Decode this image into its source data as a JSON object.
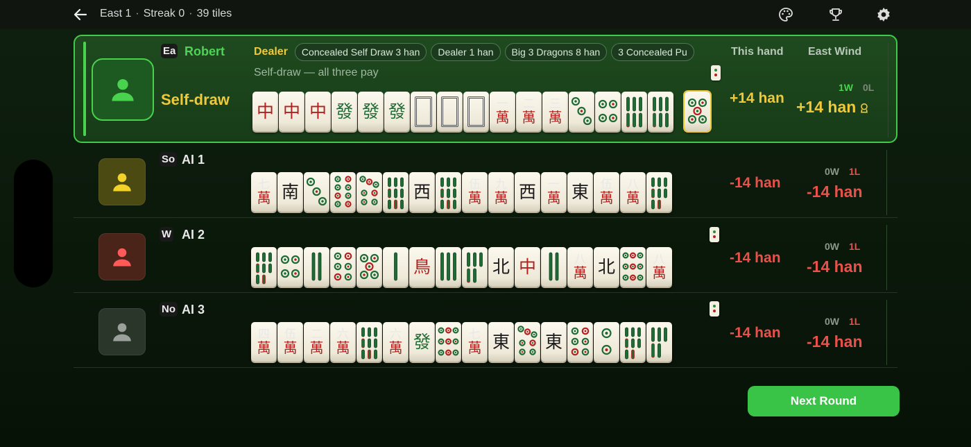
{
  "topbar": {
    "round": "East 1",
    "streak": "Streak 0",
    "tiles_left": "39 tiles",
    "separator": "·"
  },
  "headers": {
    "this_hand": "This hand",
    "east_wind": "East Wind"
  },
  "colors": {
    "win_green": "#49d24d",
    "gold": "#f0c93a",
    "loss_red": "#e8524a",
    "button_green": "#3ac447"
  },
  "players": [
    {
      "seat": "Ea",
      "name": "Robert",
      "status": "Self-draw",
      "dealer_label": "Dealer",
      "yaku": [
        "Concealed Self Draw 3 han",
        "Dealer 1 han",
        "Big 3 Dragons 8 han",
        "3 Concealed Pu"
      ],
      "description": "Self-draw — all three pay",
      "hand_value": "+14 han",
      "wins": "1W",
      "losses": "0L",
      "total": "+14 han",
      "total_icon": "crown-icon",
      "avatar_color": "#1d5a22",
      "avatar_icon_color": "#49d24d",
      "tiles": [
        "red-dragon",
        "red-dragon",
        "red-dragon",
        "green-dragon",
        "green-dragon",
        "green-dragon",
        "white-dragon",
        "white-dragon",
        "white-dragon",
        "1-wan",
        "2-wan",
        "3-wan",
        "3-dot",
        "4-dot",
        "6-bamboo",
        "6-bamboo"
      ],
      "winning_tile": "5-dot"
    },
    {
      "seat": "So",
      "name": "AI 1",
      "hand_value": "-14 han",
      "wins": "0W",
      "losses": "1L",
      "total": "-14 han",
      "avatar_color": "#4a4a12",
      "avatar_icon_color": "#f0d22a",
      "tiles": [
        "7-wan",
        "south-wind",
        "3-dot",
        "8-dot",
        "7-dot",
        "9-bamboo",
        "west-wind",
        "9-bamboo",
        "5-wan",
        "9-wan",
        "west-wind",
        "1-wan",
        "east-wind",
        "5-wan",
        "8-wan",
        "8-bamboo"
      ]
    },
    {
      "seat": "W",
      "name": "AI 2",
      "hand_value": "-14 han",
      "wins": "0W",
      "losses": "1L",
      "total": "-14 han",
      "avatar_color": "#4a2418",
      "avatar_icon_color": "#ff5a5a",
      "tiles": [
        "8-bamboo",
        "4-dot",
        "2-bamboo",
        "6-dot",
        "5-dot",
        "1-bamboo-single",
        "1-bamboo-bird",
        "3-bamboo",
        "5-bamboo",
        "north-wind",
        "red-dragon",
        "2-bamboo-single",
        "8-wan",
        "north-wind",
        "9-dot",
        "8-wan"
      ]
    },
    {
      "seat": "No",
      "name": "AI 3",
      "hand_value": "-14 han",
      "wins": "0W",
      "losses": "1L",
      "total": "-14 han",
      "avatar_color": "#2a362a",
      "avatar_icon_color": "#9aa09a",
      "tiles": [
        "4-wan",
        "5-wan",
        "2-wan",
        "6-wan",
        "9-bamboo",
        "6-wan",
        "green-dragon",
        "9-dot",
        "7-wan",
        "east-wind",
        "7-dot",
        "east-wind",
        "6-dot",
        "2-dot",
        "8-bamboo",
        "5-bamboo"
      ]
    }
  ],
  "actions": {
    "next_round": "Next Round"
  }
}
